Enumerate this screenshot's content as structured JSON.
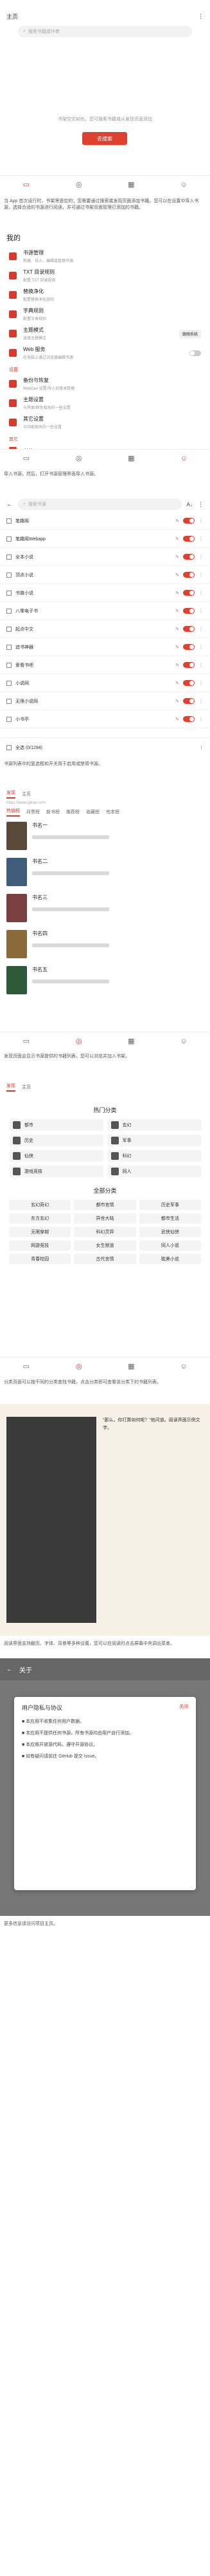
{
  "shelf": {
    "title": "主页",
    "search_placeholder": "搜索书籍或作者",
    "empty_text": "书架空空如也，您可搜索书籍或从发现页面添加",
    "button_label": "去搜索"
  },
  "para1": "当 App 首次运行时，书架将是空的；您需要通过搜索或发现页面添加书籍。您可以在设置中导入书源，选择合适的书源进行阅读，并可通过书架页面管理已添加的书籍。",
  "settings": {
    "title": "我的",
    "items": [
      {
        "title": "书源管理",
        "sub": "新建、导入、编辑或管理书源"
      },
      {
        "title": "TXT 目录规则",
        "sub": "配置 TXT 目录规则"
      },
      {
        "title": "替换净化",
        "sub": "配置替换净化规则"
      },
      {
        "title": "字典规则",
        "sub": "配置字典规则"
      },
      {
        "title": "主题模式",
        "sub": "选择主题模式"
      },
      {
        "title": "Web 服务",
        "sub": "在电脑上通过浏览器编辑书源"
      }
    ],
    "theme_value": "跟随系统",
    "section_settings": "设置",
    "setting_items": [
      {
        "title": "备份与恢复",
        "sub": "WebDav 设置/导入旧版本数据"
      },
      {
        "title": "主题设置",
        "sub": "与界面/颜色相关的一些设置"
      },
      {
        "title": "其它设置",
        "sub": "与功能相关的一些设置"
      }
    ],
    "section_other": "其它",
    "other_item": "书签"
  },
  "para2": "导入书源，然后，打开书源管理界面导入书源。",
  "sources": {
    "search_placeholder": "搜索书源",
    "select_all": "全选 (0/1294)",
    "rows": [
      "笔趣阁",
      "笔趣阁Webapp",
      "全本小说",
      "顶点小说",
      "书旗小说",
      "八零电子书",
      "起点中文",
      "追书神器",
      "爱看书吧",
      "小说网",
      "无限小说网",
      "小书亭"
    ]
  },
  "para3": "书源列表中的复选框和开关用于启用或禁用书源。",
  "discover_list": {
    "tab1": "发现",
    "tab2": "主页",
    "url": "https://www.qidian.com",
    "tabs": [
      "热销榜",
      "月票榜",
      "新书榜",
      "推荐榜",
      "收藏榜",
      "完本榜"
    ],
    "books": [
      {
        "title": "书名一"
      },
      {
        "title": "书名二"
      },
      {
        "title": "书名三"
      },
      {
        "title": "书名四"
      },
      {
        "title": "书名五"
      }
    ]
  },
  "para4": "发现页面会显示书源提供的书籍列表，您可以浏览并加入书架。",
  "categories": {
    "tab1": "发现",
    "tab2": "主页",
    "heading1": "热门分类",
    "hot": [
      "都市",
      "玄幻",
      "历史",
      "军事",
      "仙侠",
      "科幻",
      "游戏竞技",
      "同人"
    ],
    "heading2": "全部分类",
    "all": [
      "玄幻奇幻",
      "都市言情",
      "历史军事",
      "东方玄幻",
      "异世大陆",
      "都市生活",
      "无限穿越",
      "科幻灵异",
      "武侠仙侠",
      "网游竞技",
      "女生频道",
      "同人小说",
      "青春校园",
      "古代言情",
      "耽美小说"
    ]
  },
  "para5": "分类页面可以按不同的分类查找书籍，点击分类即可查看该分类下的书籍列表。",
  "reader": {
    "text": "“那么，你打算如何呢？”他问道。阅读界面示例文字。"
  },
  "para6": "阅读界面支持翻页、字体、背景等多种设置，您可以在阅读时点击屏幕中央调出菜单。",
  "about": {
    "title": "关于",
    "dialog_title": "用户隐私与协议",
    "close": "关闭",
    "bullets": [
      "本应用不收集任何用户数据。",
      "本应用不提供任何书源，所有书源均由用户自行添加。",
      "本应用开放源代码，遵守开源协议。",
      "如有疑问请前往 GitHub 提交 Issue。"
    ]
  },
  "para7": "更多信息请访问项目主页。",
  "colors": {
    "accent": "#d63b2b"
  }
}
